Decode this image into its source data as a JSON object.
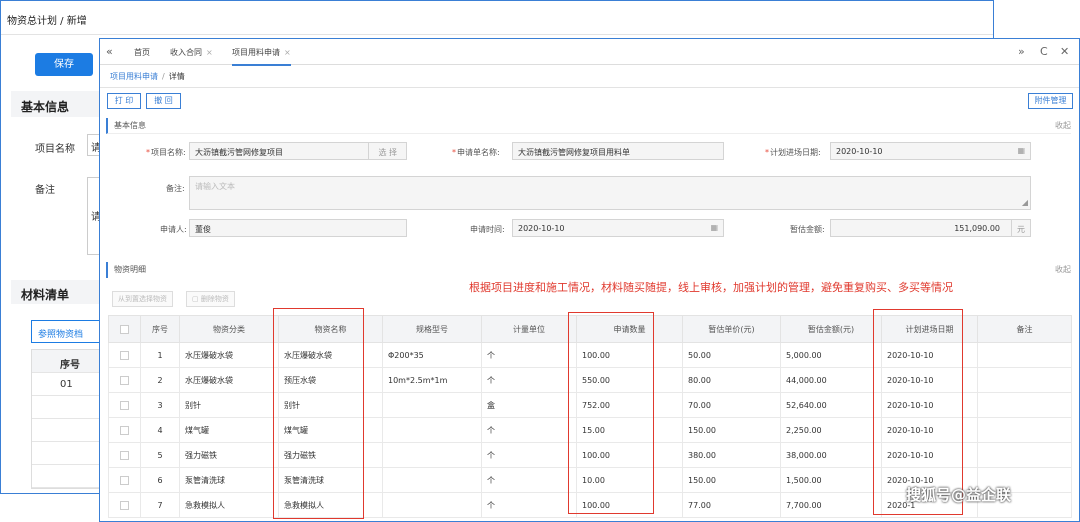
{
  "background_window": {
    "breadcrumb": "物资总计划 / 新增",
    "save_label": "保存",
    "basic_info_title": "基本信息",
    "project_name_label": "项目名称",
    "project_name_value_partial": "请",
    "remark_label": "备注",
    "remark_value_partial": "请",
    "material_list_title": "材料清单",
    "reference_button": "参照物资档",
    "table_header_seq": "序号",
    "table_first_seq": "01"
  },
  "tabs_bar": {
    "nav_icon": "double-chevron-left-icon",
    "tabs": [
      {
        "label": "首页"
      },
      {
        "label": "收入合同",
        "close": "×"
      },
      {
        "label": "项目用料申请",
        "close": "×"
      }
    ],
    "controls": {
      "expand": "»",
      "refresh": "C",
      "close": "✕"
    }
  },
  "breadcrumb": {
    "link": "项目用料申请",
    "separator": "/",
    "current": "详情"
  },
  "toolbar": {
    "print": "打 印",
    "back": "撤 回",
    "attachment": "附件管理"
  },
  "basic_section": {
    "title": "基本信息",
    "collapse": "收起",
    "fields": {
      "project_name": {
        "label": "项目名称:",
        "value": "大沥镇截污管网修复项目",
        "button": "选 择"
      },
      "request_name": {
        "label": "申请单名称:",
        "value": "大沥镇截污管网修复项目用料单"
      },
      "plan_date": {
        "label": "计划进场日期:",
        "value": "2020-10-10"
      },
      "remark": {
        "label": "备注:",
        "placeholder": "请输入文本"
      },
      "applicant": {
        "label": "申请人:",
        "value": "董俊"
      },
      "apply_time": {
        "label": "申请时间:",
        "value": "2020-10-10"
      },
      "estimated_amount": {
        "label": "暂估金额:",
        "value": "151,090.00",
        "unit": "元"
      }
    }
  },
  "detail_section": {
    "title": "物资明细",
    "collapse": "收起",
    "add_button": "从到置选择物资",
    "delete_button": "删除物资"
  },
  "annotation": "根据项目进度和施工情况，材料随买随提，线上审核，加强计划的管理，避免重复购买、多买等情况",
  "table": {
    "columns": [
      "",
      "序号",
      "物资分类",
      "物资名称",
      "规格型号",
      "计量单位",
      "申请数量",
      "暂估单价(元)",
      "暂估金额(元)",
      "计划进场日期",
      "备注"
    ],
    "rows": [
      [
        "1",
        "水压爆破水袋",
        "水压爆破水袋",
        "Φ200*35",
        "个",
        "100.00",
        "50.00",
        "5,000.00",
        "2020-10-10",
        ""
      ],
      [
        "2",
        "水压爆破水袋",
        "预压水袋",
        "10m*2.5m*1m",
        "个",
        "550.00",
        "80.00",
        "44,000.00",
        "2020-10-10",
        ""
      ],
      [
        "3",
        "别针",
        "别针",
        "",
        "盒",
        "752.00",
        "70.00",
        "52,640.00",
        "2020-10-10",
        ""
      ],
      [
        "4",
        "煤气罐",
        "煤气罐",
        "",
        "个",
        "15.00",
        "150.00",
        "2,250.00",
        "2020-10-10",
        ""
      ],
      [
        "5",
        "强力磁铁",
        "强力磁铁",
        "",
        "个",
        "100.00",
        "380.00",
        "38,000.00",
        "2020-10-10",
        ""
      ],
      [
        "6",
        "泵管清洗球",
        "泵管清洗球",
        "",
        "个",
        "10.00",
        "150.00",
        "1,500.00",
        "2020-10-10",
        ""
      ],
      [
        "7",
        "急救模拟人",
        "急救模拟人",
        "",
        "个",
        "100.00",
        "77.00",
        "7,700.00",
        "2020-1",
        ""
      ]
    ]
  },
  "watermark": "搜狐号@益企联",
  "colors": {
    "accent": "#3a7fd5",
    "primary_button": "#1c7ce3",
    "annotation_red": "#e0392e"
  }
}
